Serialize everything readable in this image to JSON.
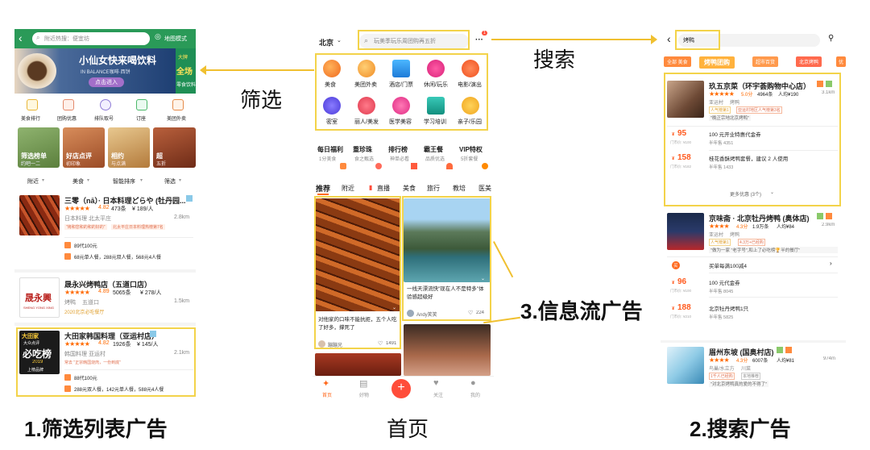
{
  "left": {
    "search_placeholder": "附近热搜：便宜坊",
    "map_mode": "地图模式",
    "banner": {
      "title": "小仙女快来喝饮料",
      "sub": "IN BALANCE咖啡·西饼",
      "cta": "点击进入",
      "side_top": "大牌",
      "side_mid": "全场",
      "side_bottom": "零食饮料"
    },
    "cats": [
      "美食排行",
      "团购优惠",
      "排队取号",
      "订座",
      "美团外卖"
    ],
    "promos": [
      "筛选榜单",
      "好店点评",
      "相约",
      "超"
    ],
    "promo_subs": [
      "约吧一二",
      "初印象",
      "与点满",
      "五折"
    ],
    "filters": [
      "附近",
      "美食",
      "智能排序",
      "筛选"
    ],
    "items": [
      {
        "name": "三零（nā）· 日本料理どらや (牡丹园...",
        "score": "4.82",
        "reviews": "473条",
        "avg": "¥ 189/人",
        "cat": "日本料理",
        "area": "北太平庄",
        "dist": "2.8km",
        "tag1": "\"烤和您和的和的好的\"",
        "tag2": "北太平庄日本料理热榜第7名",
        "deal1": "89代100元",
        "deal2": "68元单人餐，288元双人餐，568元4人餐"
      },
      {
        "name": "晟永兴烤鸭店（五道口店）",
        "score": "4.89",
        "reviews": "5065条",
        "avg": "¥ 278/人",
        "cat": "烤鸭",
        "area": "五道口",
        "dist": "1.5km",
        "tag1": "2020北京必吃餐厅",
        "brand": "晟永興",
        "brand_en": "SHENG YONG XING"
      },
      {
        "name": "大田家韩国料理（亚运村店）",
        "score": "4.82",
        "reviews": "1926条",
        "avg": "¥ 145/人",
        "cat": "韩国料理",
        "area": "亚运村",
        "dist": "2.1km",
        "tag1": "常去 \"正宗韩国烧肉，一份到底\"",
        "deal1": "88代100元",
        "deal2": "288元双人餐，142元单人餐，588元4人餐",
        "poster_title": "大田家",
        "poster_sub": "大众点评",
        "poster_big": "必吃榜",
        "poster_year": "2019",
        "poster_tag": "上榜品牌"
      }
    ]
  },
  "center": {
    "city": "北京",
    "search_placeholder": "玩美季玩乐周团购再五折",
    "more": "···",
    "badge": "1",
    "grid": [
      [
        "美食",
        "美团外卖",
        "酒店/门票",
        "休闲/玩乐",
        "电影/演出"
      ],
      [
        "密室",
        "丽人/美发",
        "医学美容",
        "学习培训",
        "亲子/乐园"
      ]
    ],
    "promos": [
      {
        "t": "每日福利",
        "s": "1分美食"
      },
      {
        "t": "重珍珠",
        "s": "食之甄选"
      },
      {
        "t": "排行榜",
        "s": "神单必看"
      },
      {
        "t": "霸王餐",
        "s": "品质优选"
      },
      {
        "t": "VIP特权",
        "s": "5折套餐"
      }
    ],
    "tabs": [
      "推荐",
      "附近",
      "直播",
      "美食",
      "旅行",
      "教培",
      "医美"
    ],
    "card1": {
      "desc": "对他家的口味不能抗拒，五个人吃了好多，撑死了",
      "user": "蹦蹦兄",
      "likes": "1491"
    },
    "card2": {
      "desc": "一线天漂流快\"现在人不是特多\"体验感超级好",
      "user": "Andy笑笑",
      "likes": "224"
    },
    "nav": [
      "首页",
      "好物",
      "",
      "关注",
      "我的"
    ]
  },
  "right": {
    "search_value": "烤鸭",
    "chips": [
      "全部 美食",
      "烤鸭团购",
      "超市百货",
      "北京烤鸭",
      "优"
    ],
    "ad": {
      "name": "玖五京菜（环宇荟购物中心店）",
      "score": "5.0分",
      "reviews": "4964条",
      "avg": "人均¥190",
      "dist": "3.1km",
      "area": "亚运村",
      "cat": "烤鸭",
      "tag1": "人气榜第1",
      "tag2": "亚运村地区人气榜第3名",
      "quote": "\"晚正宗地北京烤鸭\"",
      "deals": [
        {
          "price": "95",
          "orig": "门市价: ¥100",
          "title": "100 元开业特惠代金券",
          "sold": "半年售 4351"
        },
        {
          "price": "158",
          "orig": "门市价: ¥182",
          "title": "桂花香酥烤鸭套餐，建议 2 人使用",
          "sold": "半年售 1433"
        }
      ],
      "more": "更多优惠 (3个)"
    },
    "item2": {
      "name": "京味斋 · 北京牡丹烤鸭 (奥体店)",
      "score": "4.3分",
      "reviews": "1.9万条",
      "avg": "人均¥84",
      "dist": "2.9km",
      "area": "亚运村",
      "cat": "烤鸭",
      "tag1": "人气榜第1",
      "tag2": "4.3万+已经购",
      "quote": "\"做为一家 \"老字号\",和上了必吃榜🏆半的餐厅\"",
      "buy_label": "买",
      "buy": "买单每满100减4",
      "deals": [
        {
          "price": "96",
          "orig": "门市价: ¥100",
          "title": "100 元代金券",
          "sold": "半年售 8045"
        },
        {
          "price": "188",
          "orig": "门市价: ¥210",
          "title": "北京牡丹烤鸭1只",
          "sold": "半年售 5825"
        }
      ]
    },
    "item3": {
      "name": "眉州东坡 (国奥村店)",
      "score": "4.3分",
      "reviews": "6007条",
      "avg": "人均¥81",
      "dist": "974m",
      "area": "鸟巢/水立方",
      "cat": "川菜",
      "tag1": "1千人已经购",
      "tag2": "本地推荐",
      "quote": "\"对北京烤鸭真的爱的不得了\""
    }
  },
  "labels": {
    "filter": "筛选",
    "search": "搜索",
    "feed": "3.信息流广告",
    "cap_left": "1.筛选列表广告",
    "cap_center": "首页",
    "cap_right": "2.搜索广告"
  }
}
